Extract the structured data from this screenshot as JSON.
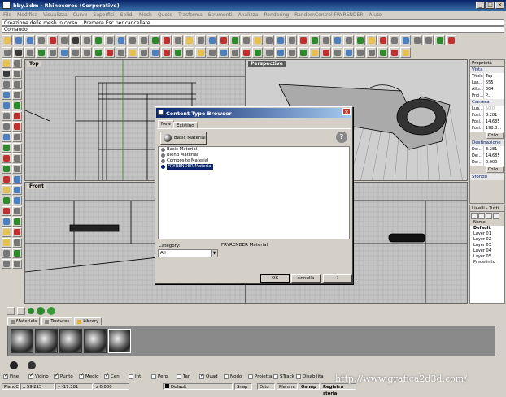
{
  "window": {
    "title": "bby.3dm - Rhinoceros (Corporative)",
    "min": "_",
    "max": "□",
    "close": "×"
  },
  "menu": [
    "File",
    "Modifica",
    "Visualizza",
    "Curve",
    "Superfici",
    "Solidi",
    "Mesh",
    "Quote",
    "Trasforma",
    "Strumenti",
    "Analizza",
    "Rendering",
    "RandomControl FRYRENDER",
    "Aiuto"
  ],
  "command_history": "Creazione delle mesh in corso... Premere Esc per cancellare",
  "command_prompt": "Comando:",
  "viewports": {
    "top": "Top",
    "perspective": "Perspective",
    "front": "Front"
  },
  "properties": {
    "header": "Proprietà",
    "section_view": "Vista",
    "rows": [
      {
        "k": "Titolo",
        "v": "Top"
      },
      {
        "k": "Lar...",
        "v": "555"
      },
      {
        "k": "Alte...",
        "v": "304"
      },
      {
        "k": "Proi...",
        "v": "P..."
      }
    ],
    "section_camera": "Camera",
    "cam_rows": [
      {
        "k": "Lun...",
        "v": "50.0"
      },
      {
        "k": "Posi...",
        "v": "8.281"
      },
      {
        "k": "Posi...",
        "v": "14.685"
      },
      {
        "k": "Posi...",
        "v": "198.8..."
      }
    ],
    "cam_btn": "Collo...",
    "section_target": "Destinazione",
    "tgt_rows": [
      {
        "k": "De...",
        "v": "8.281"
      },
      {
        "k": "De...",
        "v": "14.685"
      },
      {
        "k": "De...",
        "v": "0.000"
      }
    ],
    "tgt_btn": "Collo...",
    "section_bg": "Sfondo"
  },
  "layers": {
    "header": "Livelli - Tutti ...",
    "col": "Nome",
    "rows": [
      "Default",
      "Layer 01",
      "Layer 02",
      "Layer 03",
      "Layer 04",
      "Layer 05",
      "Predefinito"
    ]
  },
  "dialog": {
    "title": "Content Type Browser",
    "tabs": [
      "New",
      "Existing"
    ],
    "basic_btn": "Basic Material",
    "help": "?",
    "items": [
      "Basic Material",
      "Blend Material",
      "Composite Material",
      "FRYRENDER Material"
    ],
    "selected_index": 3,
    "category_label": "Category:",
    "category_value": "All",
    "description": "FRYRENDER Material",
    "ok": "OK",
    "cancel": "Annulla",
    "help_btn": "?"
  },
  "materials_panel": {
    "tabs": [
      "Materials",
      "Textures",
      "Library"
    ]
  },
  "osnaps": [
    {
      "label": "Fine",
      "on": true
    },
    {
      "label": "Vicino",
      "on": true
    },
    {
      "label": "Punto",
      "on": true
    },
    {
      "label": "Medio",
      "on": true
    },
    {
      "label": "Cen",
      "on": true
    },
    {
      "label": "Int",
      "on": false
    },
    {
      "label": "Perp",
      "on": false
    },
    {
      "label": "Tan",
      "on": false
    },
    {
      "label": "Quad",
      "on": true
    },
    {
      "label": "Nodo",
      "on": false
    },
    {
      "label": "Proietta",
      "on": false
    },
    {
      "label": "STrack",
      "on": false
    },
    {
      "label": "Disabilita",
      "on": false
    }
  ],
  "status": {
    "plane": "PianoC",
    "x": "x 59.215",
    "y": "y -17.381",
    "z": "z 0.000",
    "layer": "Default",
    "snap": "Snap",
    "ortho": "Orto",
    "planar": "Planare",
    "osnap": "Osnap",
    "history": "Registra storia"
  },
  "watermark": "http://www.grafica2d3d.com/"
}
